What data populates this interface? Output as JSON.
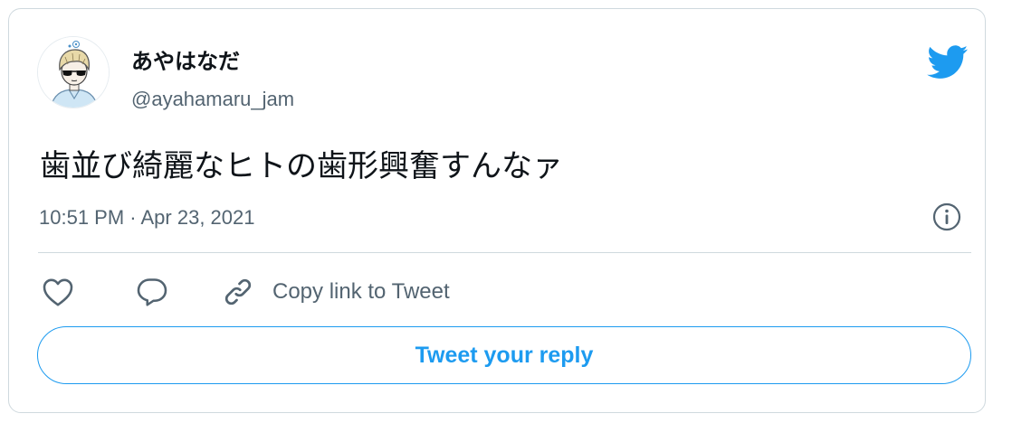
{
  "author": {
    "display_name": "あやはなだ",
    "handle": "@ayahamaru_jam"
  },
  "tweet": {
    "text": "歯並び綺麗なヒトの歯形興奮すんなァ",
    "timestamp": "10:51 PM · Apr 23, 2021"
  },
  "actions": {
    "copy_link_label": "Copy link to Tweet",
    "reply_button_label": "Tweet your reply"
  },
  "icons": {
    "brand": "twitter-bird-icon",
    "info": "info-icon",
    "like": "heart-icon",
    "reply": "speech-bubble-icon",
    "copy": "link-icon"
  },
  "colors": {
    "accent": "#1d9bf0",
    "text_primary": "#0f1419",
    "text_secondary": "#536471",
    "border": "#cfd9de"
  }
}
